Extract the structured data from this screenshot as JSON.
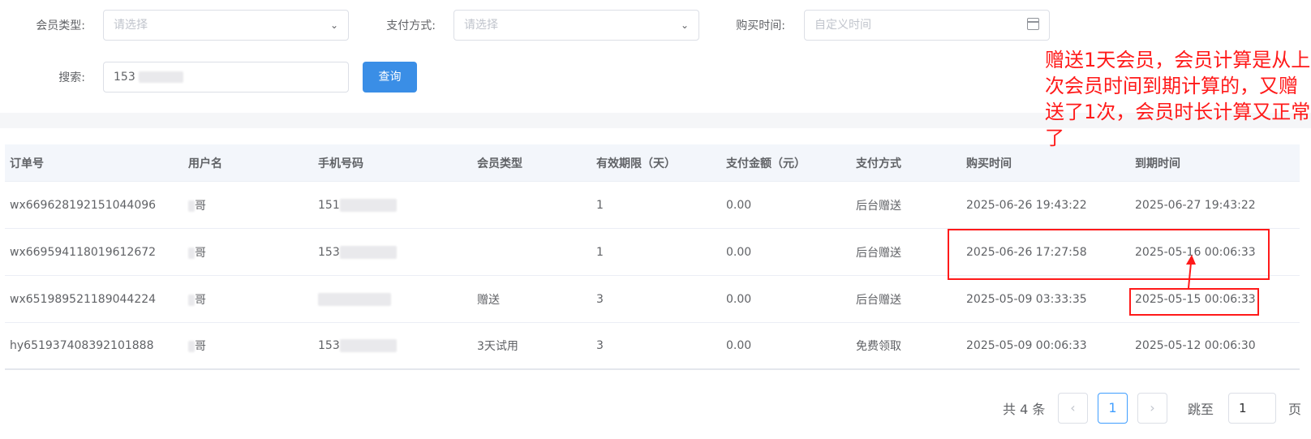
{
  "filters": {
    "member_type_label": "会员类型:",
    "member_type_placeholder": "请选择",
    "pay_method_label": "支付方式:",
    "pay_method_placeholder": "请选择",
    "buy_time_label": "购买时间:",
    "buy_time_placeholder": "自定义时间",
    "search_label": "搜索:",
    "search_value": "153",
    "query_button": "查询"
  },
  "table": {
    "headers": [
      "订单号",
      "用户名",
      "手机号码",
      "会员类型",
      "有效期限（天）",
      "支付金额（元）",
      "支付方式",
      "购买时间",
      "到期时间"
    ],
    "rows": [
      {
        "order": "wx669628192151044096",
        "user": "哥",
        "phone": "151",
        "type": "",
        "days": "1",
        "amount": "0.00",
        "method": "后台赠送",
        "buy": "2025-06-26 19:43:22",
        "expire": "2025-06-27 19:43:22"
      },
      {
        "order": "wx669594118019612672",
        "user": "哥",
        "phone": "153",
        "type": "",
        "days": "1",
        "amount": "0.00",
        "method": "后台赠送",
        "buy": "2025-06-26 17:27:58",
        "expire": "2025-05-16 00:06:33"
      },
      {
        "order": "wx651989521189044224",
        "user": "哥",
        "phone": "",
        "type": "赠送",
        "days": "3",
        "amount": "0.00",
        "method": "后台赠送",
        "buy": "2025-05-09 03:33:35",
        "expire": "2025-05-15 00:06:33"
      },
      {
        "order": "hy651937408392101888",
        "user": "哥",
        "phone": "153",
        "type": "3天试用",
        "days": "3",
        "amount": "0.00",
        "method": "免费领取",
        "buy": "2025-05-09 00:06:33",
        "expire": "2025-05-12 00:06:30"
      }
    ]
  },
  "pagination": {
    "total": "共 4 条",
    "prev_icon": "chevron-left-icon",
    "current_page": "1",
    "next_icon": "chevron-right-icon",
    "jump_label": "跳至",
    "jump_value": "1",
    "page_suffix": "页"
  },
  "annotation": {
    "text": "赠送1天会员，会员计算是从上次会员时间到期计算的，又赠送了1次，会员时长计算又正常了",
    "color": "#ff1a1a"
  },
  "colors": {
    "primary": "#409eff",
    "query_button": "#3a8ee6",
    "header_bg": "#f3f6fb"
  }
}
